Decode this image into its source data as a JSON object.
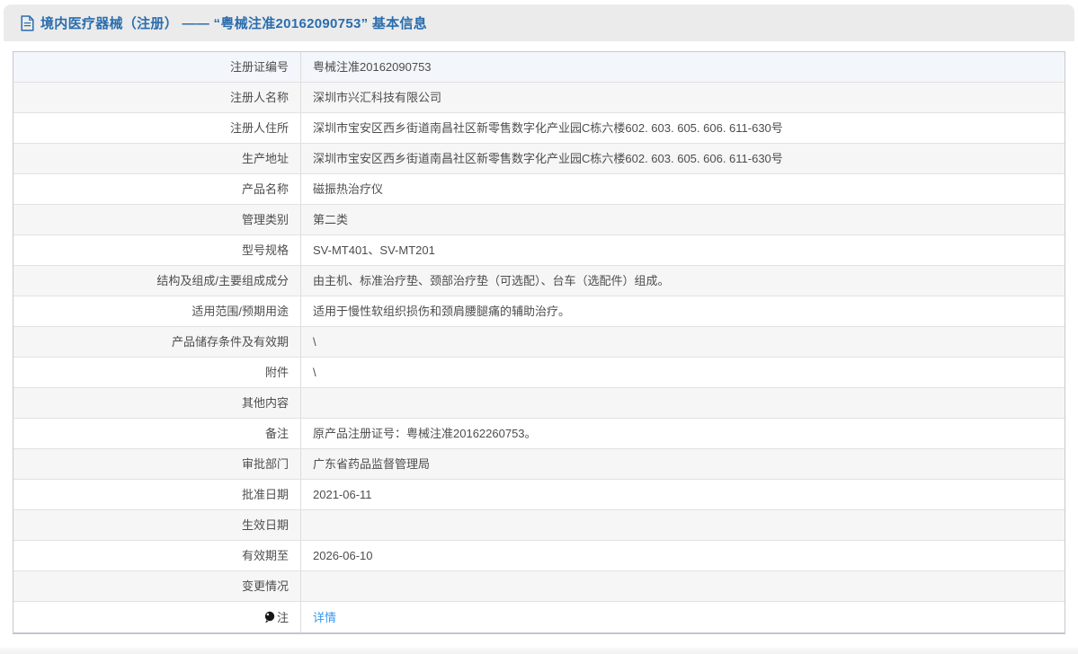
{
  "header": {
    "title": "境内医疗器械（注册） —— “粤械注准20162090753” 基本信息",
    "icon": "document-icon"
  },
  "table": {
    "rows": [
      {
        "label": "注册证编号",
        "value": "粤械注准20162090753"
      },
      {
        "label": "注册人名称",
        "value": "深圳市兴汇科技有限公司"
      },
      {
        "label": "注册人住所",
        "value": "深圳市宝安区西乡街道南昌社区新零售数字化产业园C栋六楼602. 603. 605. 606. 611-630号"
      },
      {
        "label": "生产地址",
        "value": "深圳市宝安区西乡街道南昌社区新零售数字化产业园C栋六楼602. 603. 605. 606. 611-630号"
      },
      {
        "label": "产品名称",
        "value": "磁振热治疗仪"
      },
      {
        "label": "管理类别",
        "value": "第二类"
      },
      {
        "label": "型号规格",
        "value": "SV-MT401、SV-MT201"
      },
      {
        "label": "结构及组成/主要组成成分",
        "value": "由主机、标准治疗垫、颈部治疗垫（可选配）、台车（选配件）组成。"
      },
      {
        "label": "适用范围/预期用途",
        "value": "适用于慢性软组织损伤和颈肩腰腿痛的辅助治疗。"
      },
      {
        "label": "产品储存条件及有效期",
        "value": "\\"
      },
      {
        "label": "附件",
        "value": "\\"
      },
      {
        "label": "其他内容",
        "value": ""
      },
      {
        "label": "备注",
        "value": "原产品注册证号：粤械注准20162260753。"
      },
      {
        "label": "审批部门",
        "value": "广东省药品监督管理局"
      },
      {
        "label": "批准日期",
        "value": "2021-06-11"
      },
      {
        "label": "生效日期",
        "value": ""
      },
      {
        "label": "有效期至",
        "value": "2026-06-10"
      },
      {
        "label": "变更情况",
        "value": ""
      },
      {
        "label": "注",
        "icon": "balloon-icon",
        "value": "详情",
        "link": true
      }
    ]
  },
  "colors": {
    "accent_blue": "#2a6dad",
    "link_blue": "#3a96ee",
    "stripe_gray": "#f6f6f6",
    "hover_row_blue": "#f3f6fa",
    "header_bar_gray": "#ebebeb",
    "border_gray": "#dcdcdc"
  }
}
